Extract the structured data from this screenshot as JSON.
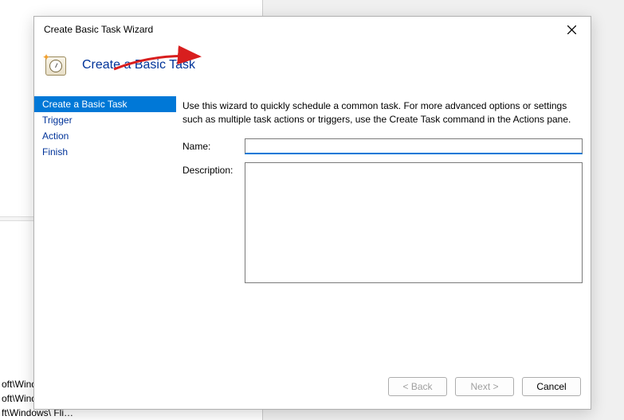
{
  "bg": {
    "items": [
      "oft\\Windo…",
      "oft\\Windows\\U…",
      "ft\\Windows\\ Fli…"
    ]
  },
  "dialog": {
    "title": "Create Basic Task Wizard",
    "headerTitle": "Create a Basic Task",
    "instructions": "Use this wizard to quickly schedule a common task.  For more advanced options or settings such as multiple task actions or triggers, use the Create Task command in the Actions pane.",
    "sidebar": [
      {
        "label": "Create a Basic Task",
        "selected": true
      },
      {
        "label": "Trigger",
        "selected": false
      },
      {
        "label": "Action",
        "selected": false
      },
      {
        "label": "Finish",
        "selected": false
      }
    ],
    "form": {
      "nameLabel": "Name:",
      "nameValue": "",
      "descLabel": "Description:",
      "descValue": ""
    },
    "buttons": {
      "back": "< Back",
      "next": "Next >",
      "cancel": "Cancel"
    }
  }
}
